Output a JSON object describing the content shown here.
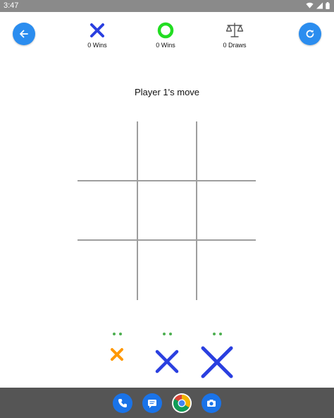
{
  "status_bar": {
    "time": "3:47",
    "icons": [
      "wifi-icon",
      "signal-icon",
      "battery-icon"
    ]
  },
  "header": {
    "back_icon": "arrow-left-icon",
    "refresh_icon": "refresh-icon",
    "scores": [
      {
        "icon": "x-icon",
        "label": "0 Wins"
      },
      {
        "icon": "o-icon",
        "label": "0 Wins"
      },
      {
        "icon": "scale-icon",
        "label": "0 Draws"
      }
    ]
  },
  "game": {
    "turn_text": "Player 1's move",
    "board_cells": [
      "",
      "",
      "",
      "",
      "",
      "",
      "",
      "",
      ""
    ]
  },
  "pieces": [
    {
      "size": "small",
      "color": "#ff9800"
    },
    {
      "size": "medium",
      "color": "#2a3fe0"
    },
    {
      "size": "large",
      "color": "#2a3fe0"
    }
  ],
  "dock": {
    "apps": [
      "phone-icon",
      "messages-icon",
      "chrome-icon",
      "camera-icon"
    ]
  },
  "colors": {
    "accent": "#2b8def",
    "player_x": "#2a3fe0",
    "player_o": "#22dd22",
    "grid": "#9e9e9e",
    "dots": "#4caf50"
  }
}
